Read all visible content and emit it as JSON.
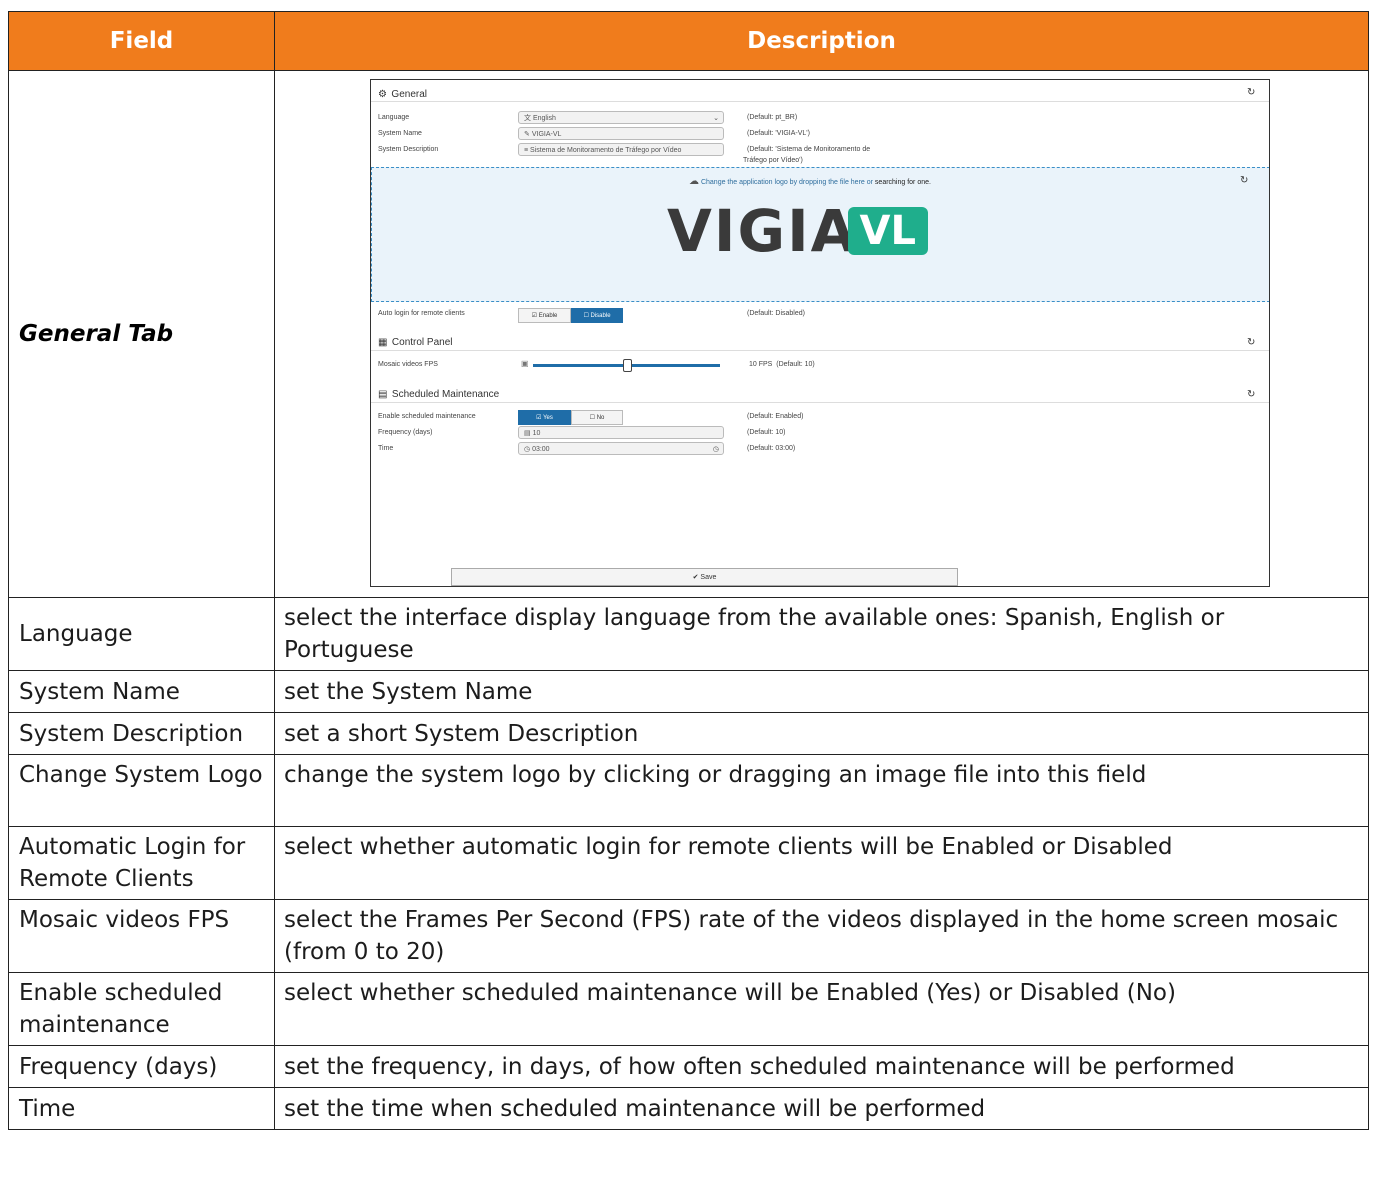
{
  "header": {
    "field": "Field",
    "description": "Description"
  },
  "general_tab_label": "General Tab",
  "screenshot": {
    "general_title": "General",
    "language_label": "Language",
    "language_value": "English",
    "language_default": "(Default: pt_BR)",
    "system_name_label": "System Name",
    "system_name_value": "VIGIA-VL",
    "system_name_default": "(Default: 'VIGIA-VL')",
    "system_description_label": "System Description",
    "system_description_value": "Sistema de Monitoramento de Tráfego por Vídeo",
    "system_description_default_line1": "(Default: 'Sistema de Monitoramento de",
    "system_description_default_line2": "Tráfego por Vídeo')",
    "logo_hint": "Change the application logo by dropping the file here or",
    "logo_hint_link": "searching for one.",
    "logo_main": "VIGIA",
    "logo_badge": "VL",
    "auto_login_label": "Auto login for remote clients",
    "enable_label": "Enable",
    "disable_label": "Disable",
    "auto_login_default": "(Default: Disabled)",
    "control_panel_title": "Control Panel",
    "mosaic_label": "Mosaic videos FPS",
    "mosaic_value": "10 FPS",
    "mosaic_default": "(Default: 10)",
    "mosaic_fraction": 0.5,
    "maintenance_title": "Scheduled Maintenance",
    "enable_maint_label": "Enable scheduled maintenance",
    "yes_label": "Yes",
    "no_label": "No",
    "enable_maint_default": "(Default: Enabled)",
    "frequency_label": "Frequency (days)",
    "frequency_value": "10",
    "frequency_default": "(Default: 10)",
    "time_label": "Time",
    "time_value": "03:00",
    "time_default": "(Default: 03:00)",
    "save_label": "Save"
  },
  "rows": [
    {
      "field": "Language",
      "description": "select the interface display language from the available ones: Spanish, English or Portuguese"
    },
    {
      "field": "System Name",
      "description": "set the System Name"
    },
    {
      "field": "System Description",
      "description": "set a short System Description"
    },
    {
      "field": "Change System Logo",
      "description": "change the system logo by clicking or dragging an image file into this field"
    },
    {
      "field": "Automatic Login for Remote Clients",
      "description": "select whether automatic login for remote clients will be Enabled or Disabled"
    },
    {
      "field": "Mosaic videos FPS",
      "description": "select the Frames Per Second (FPS) rate of the videos displayed in the home screen mosaic (from 0 to 20)"
    },
    {
      "field": "Enable scheduled maintenance",
      "description": "select whether scheduled maintenance will be Enabled (Yes) or Disabled (No)"
    },
    {
      "field": "Frequency (days)",
      "description": "set the frequency, in days, of how often scheduled maintenance will be performed"
    },
    {
      "field": "Time",
      "description": "set the time when scheduled maintenance will be performed"
    }
  ],
  "colors": {
    "header_bg": "#f07c1c",
    "accent_blue": "#1f6da8",
    "logo_dark": "#3a3a3a",
    "logo_green": "#1fae8c"
  }
}
